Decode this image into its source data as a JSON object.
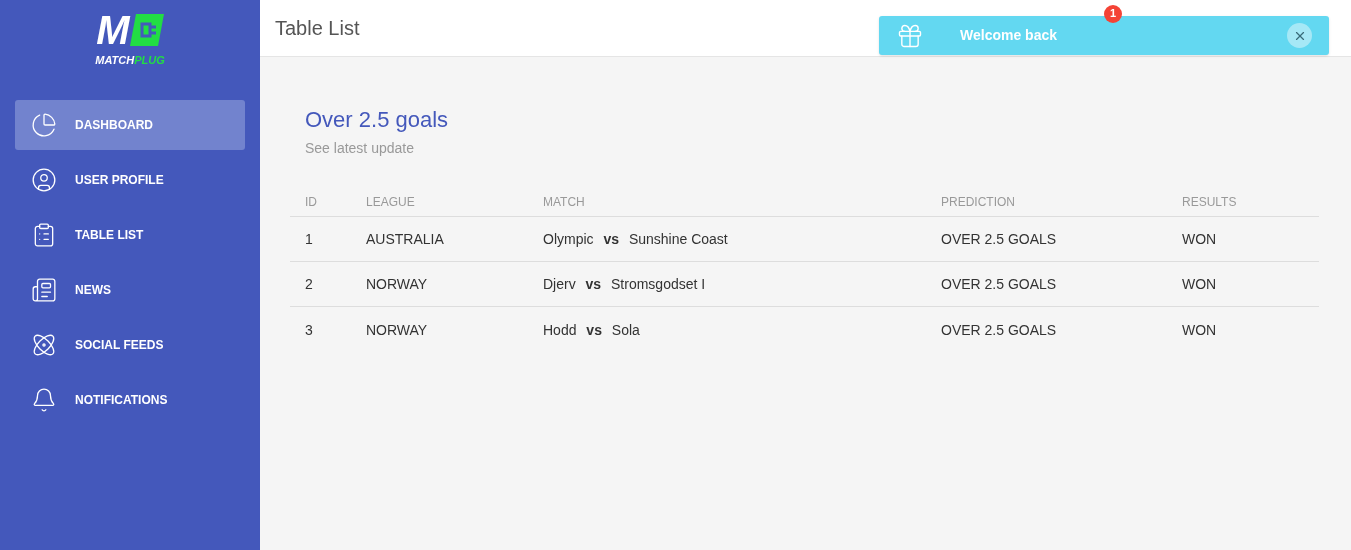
{
  "logo": {
    "mark": "M",
    "word_1": "MATCH",
    "word_2": "PLUG"
  },
  "sidebar": {
    "items": [
      {
        "label": "DASHBOARD",
        "kind": "pie",
        "selected": true
      },
      {
        "label": "USER PROFILE",
        "kind": "user",
        "selected": false
      },
      {
        "label": "TABLE LIST",
        "kind": "clipboard",
        "selected": false
      },
      {
        "label": "NEWS",
        "kind": "news",
        "selected": false
      },
      {
        "label": "SOCIAL FEEDS",
        "kind": "atom",
        "selected": false
      },
      {
        "label": "NOTIFICATIONS",
        "kind": "bell",
        "selected": false
      }
    ]
  },
  "header": {
    "title": "Table List",
    "badge": "1"
  },
  "toast": {
    "message": "Welcome back"
  },
  "card": {
    "title": "Over 2.5 goals",
    "subtitle": "See latest update"
  },
  "table": {
    "columns": [
      "ID",
      "LEAGUE",
      "MATCH",
      "PREDICTION",
      "RESULTS"
    ],
    "rows": [
      {
        "id": "1",
        "league": "AUSTRALIA",
        "match": "Olympic **vs** Sunshine Coast",
        "prediction": "OVER 2.5 GOALS",
        "result": "WON"
      },
      {
        "id": "2",
        "league": "NORWAY",
        "match": "Djerv **vs** Stromsgodset I",
        "prediction": "OVER 2.5 GOALS",
        "result": "WON"
      },
      {
        "id": "3",
        "league": "NORWAY",
        "match": "Hodd **vs** Sola",
        "prediction": "OVER 2.5 GOALS",
        "result": "WON"
      }
    ]
  }
}
